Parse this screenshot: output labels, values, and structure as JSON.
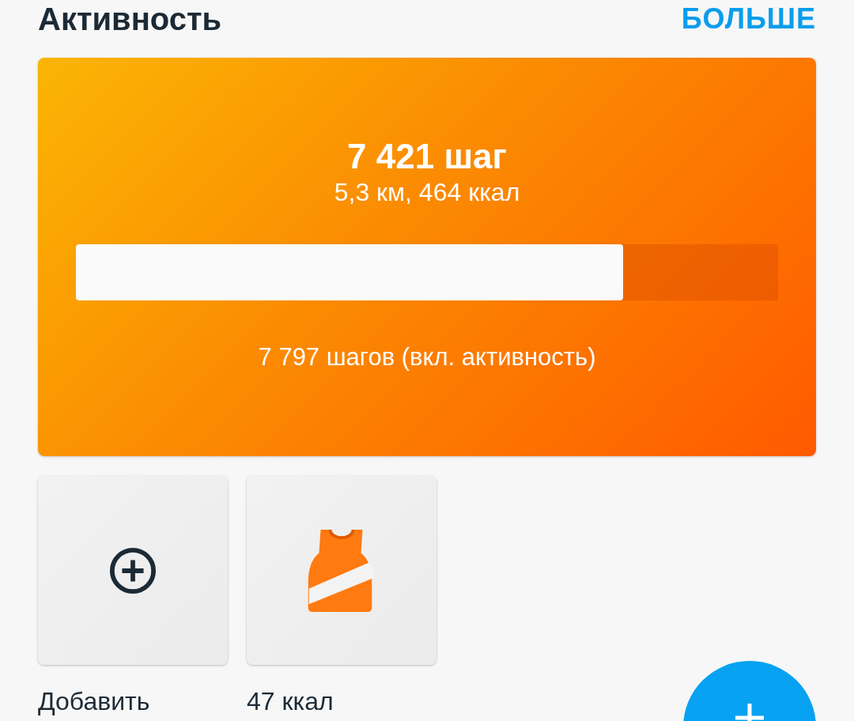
{
  "header": {
    "title": "Активность",
    "more_link": "БОЛЬШЕ"
  },
  "summary": {
    "steps": "7 421 шаг",
    "details": "5,3 км, 464 ккал",
    "progress": {
      "level": 0.779
    },
    "total": "7 797 шагов (вкл. активность)"
  },
  "tiles": [
    {
      "kind": "add",
      "label": "Добавить"
    },
    {
      "kind": "workout",
      "label": "47 ккал"
    }
  ]
}
